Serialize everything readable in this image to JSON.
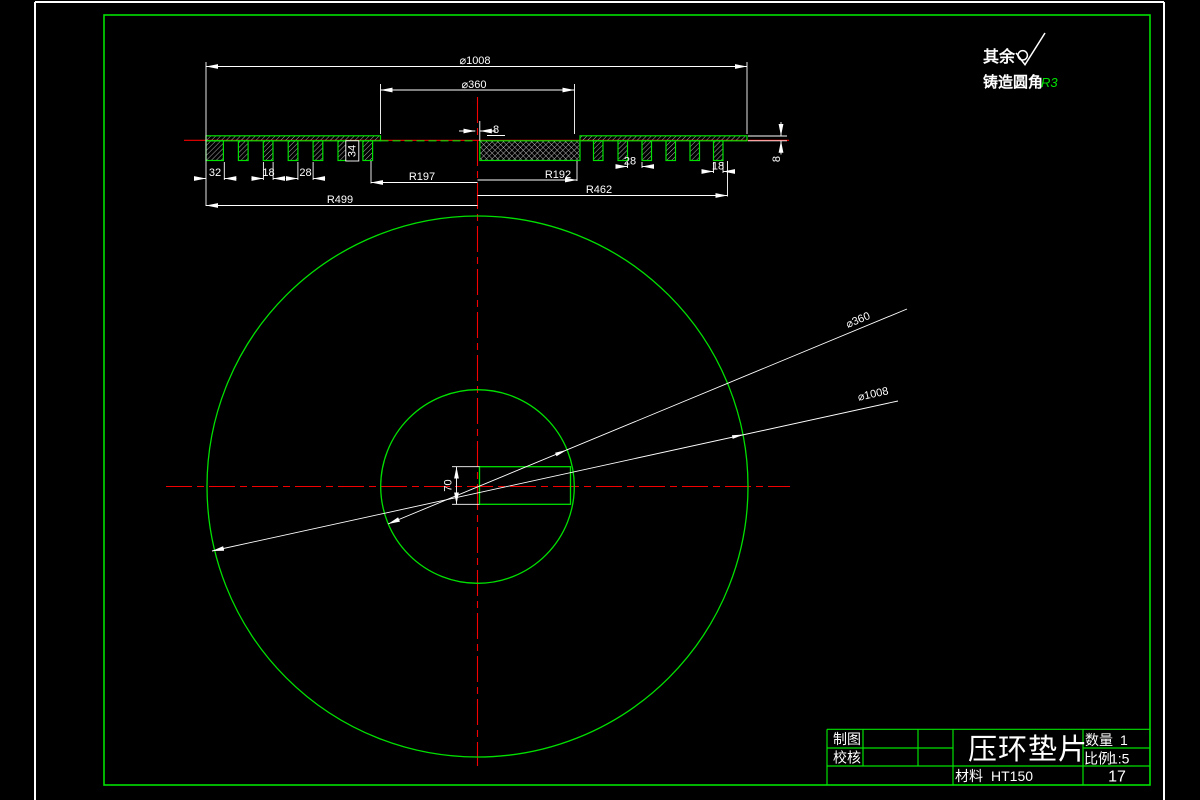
{
  "notes": {
    "other_surfaces": "其余",
    "cast_fillet_label": "铸造圆角",
    "cast_fillet_value": "R3"
  },
  "section_dims": {
    "d1008": "⌀1008",
    "d360": "⌀360",
    "slot8": "8",
    "r197": "R197",
    "r192": "R192",
    "r462": "R462",
    "r499": "R499",
    "w32": "32",
    "w18_left": "18",
    "w28_left": "28",
    "w28_right": "28",
    "w18_right": "18",
    "thickness8_right": "8",
    "h34": "34"
  },
  "plan_dims": {
    "keyway70": "70",
    "d360_leader": "⌀360",
    "d1008_leader": "⌀1008"
  },
  "title_block": {
    "drawn_label": "制图",
    "checked_label": "校核",
    "part_name": "压环垫片",
    "qty_label": "数量",
    "qty_value": "1",
    "scale_label": "比例",
    "scale_value": "1:5",
    "material_label": "材料",
    "material_value": "HT150",
    "sheet_no": "17"
  },
  "colors": {
    "geometry_green": "#00e000",
    "centerline_red": "#f20000",
    "dimension_white": "#ffffff",
    "background": "#000000"
  }
}
